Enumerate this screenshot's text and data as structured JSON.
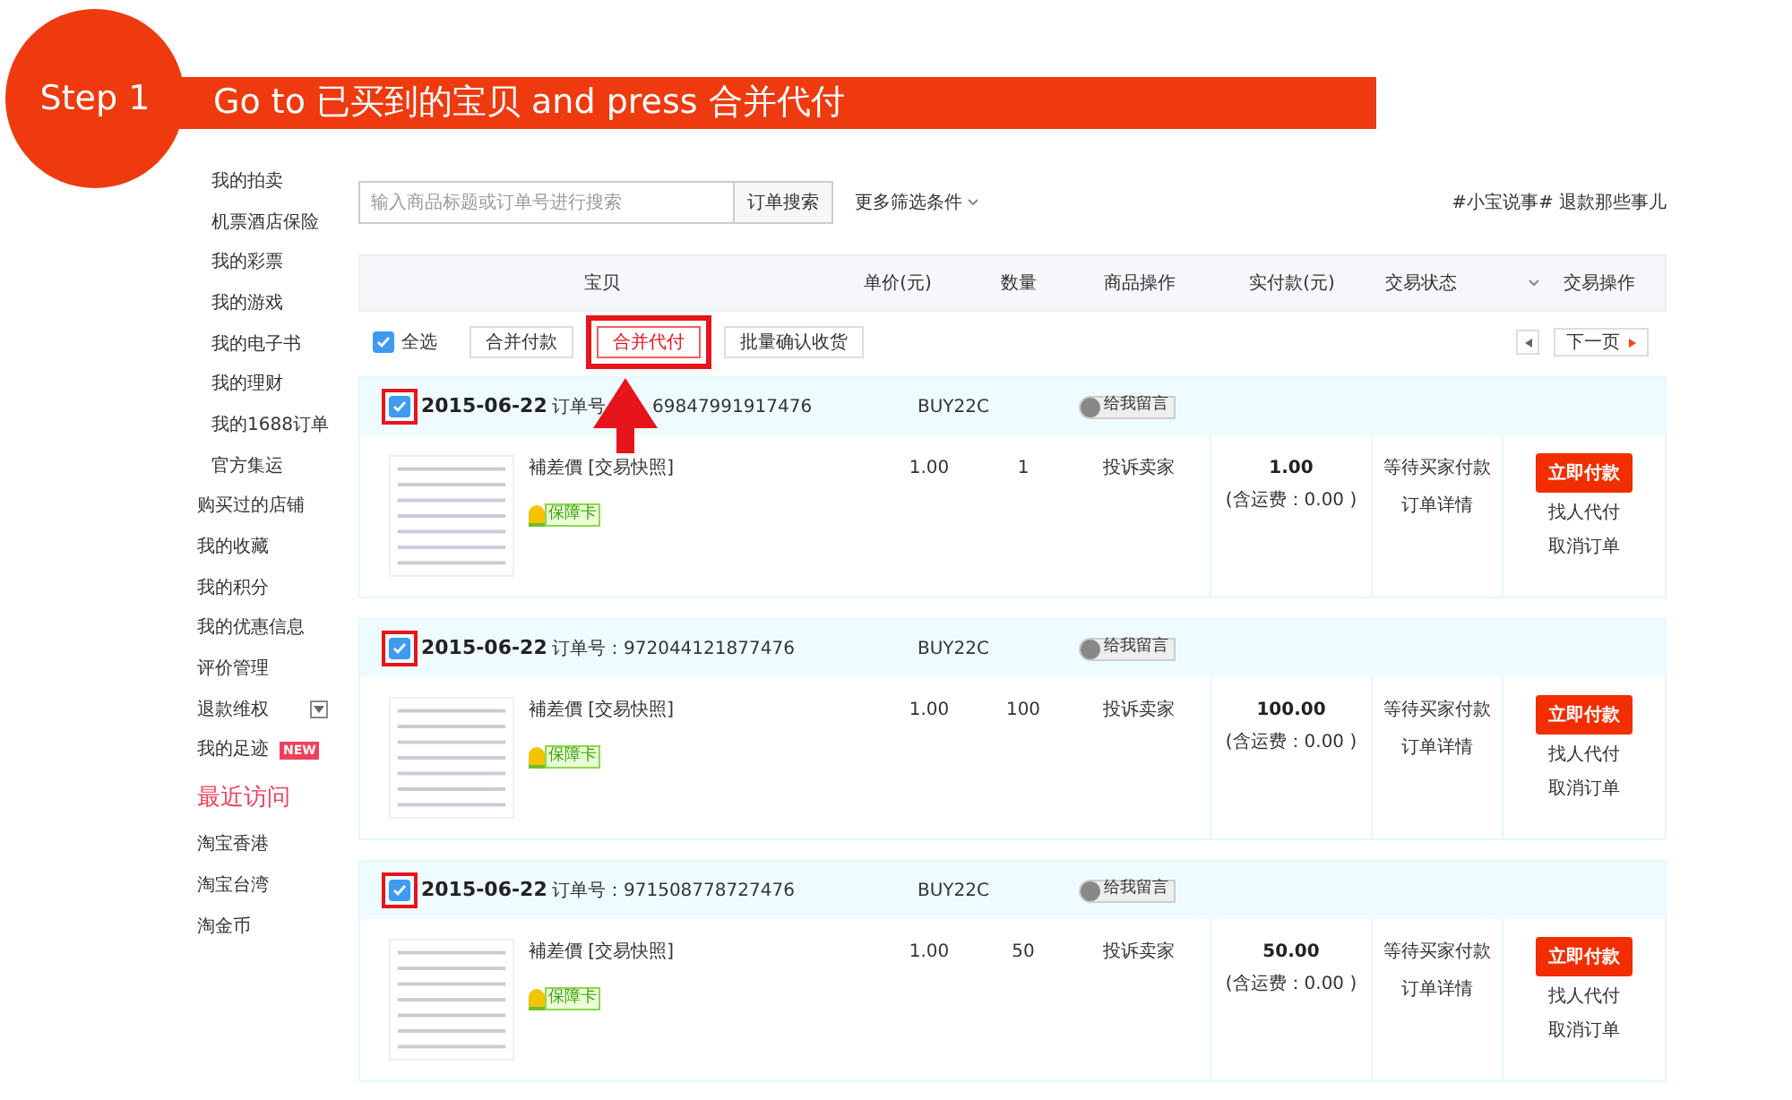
{
  "banner": {
    "step": "Step 1",
    "text": "Go to 已买到的宝贝 and press 合并代付"
  },
  "sidebar": {
    "items": [
      {
        "label": "我的拍卖",
        "kind": "sub"
      },
      {
        "label": "机票酒店保险",
        "kind": "sub"
      },
      {
        "label": "我的彩票",
        "kind": "sub"
      },
      {
        "label": "我的游戏",
        "kind": "sub"
      },
      {
        "label": "我的电子书",
        "kind": "sub"
      },
      {
        "label": "我的理财",
        "kind": "sub"
      },
      {
        "label": "我的1688订单",
        "kind": "sub"
      },
      {
        "label": "官方集运",
        "kind": "sub"
      },
      {
        "label": "购买过的店铺",
        "kind": "main"
      },
      {
        "label": "我的收藏",
        "kind": "main"
      },
      {
        "label": "我的积分",
        "kind": "main"
      },
      {
        "label": "我的优惠信息",
        "kind": "main"
      },
      {
        "label": "评价管理",
        "kind": "main"
      },
      {
        "label": "退款维权",
        "kind": "menu"
      },
      {
        "label": "我的足迹",
        "kind": "main",
        "badge": "NEW"
      },
      {
        "label": "最近访问",
        "kind": "heading"
      },
      {
        "label": "淘宝香港",
        "kind": "main"
      },
      {
        "label": "淘宝台湾",
        "kind": "main"
      },
      {
        "label": "淘金币",
        "kind": "main"
      }
    ]
  },
  "search": {
    "placeholder": "输入商品标题或订单号进行搜索",
    "button": "订单搜索",
    "filter": "更多筛选条件"
  },
  "hashtag": "#小宝说事# 退款那些事儿",
  "table": {
    "columns": [
      {
        "label": "宝贝",
        "kind": "plain"
      },
      {
        "label": "单价(元)",
        "kind": "plain"
      },
      {
        "label": "数量",
        "kind": "plain"
      },
      {
        "label": "商品操作",
        "kind": "plain"
      },
      {
        "label": "实付款(元)",
        "kind": "plain"
      },
      {
        "label": "交易状态",
        "kind": "dropdown"
      },
      {
        "label": "交易操作",
        "kind": "plain"
      }
    ]
  },
  "toolbar": {
    "select_all": {
      "label": "全选",
      "checked": true
    },
    "buttons": [
      {
        "label": "合并付款",
        "highlighted": false
      },
      {
        "label": "合并代付",
        "highlighted": true
      },
      {
        "label": "批量确认收货",
        "highlighted": false
      }
    ],
    "next_page": "下一页"
  },
  "orders": [
    {
      "checked": true,
      "highlighted": true,
      "date": "2015-06-22",
      "order_label": "订单号",
      "order_no": "69847991917476",
      "seller": "BUY22C",
      "message": "给我留言",
      "title": "補差價 [交易快照]",
      "badge": "保障卡",
      "price": "1.00",
      "qty": "1",
      "item_action": "投诉卖家",
      "total": "1.00",
      "shipping": "(含运费：0.00 )",
      "status": "等待买家付款",
      "detail": "订单详情",
      "pay_button": "立即付款",
      "actions": [
        "找人代付",
        "取消订单"
      ]
    },
    {
      "checked": true,
      "highlighted": true,
      "date": "2015-06-22",
      "order_label": "订单号：",
      "order_no": "972044121877476",
      "seller": "BUY22C",
      "message": "给我留言",
      "title": "補差價 [交易快照]",
      "badge": "保障卡",
      "price": "1.00",
      "qty": "100",
      "item_action": "投诉卖家",
      "total": "100.00",
      "shipping": "(含运费：0.00 )",
      "status": "等待买家付款",
      "detail": "订单详情",
      "pay_button": "立即付款",
      "actions": [
        "找人代付",
        "取消订单"
      ]
    },
    {
      "checked": true,
      "highlighted": true,
      "date": "2015-06-22",
      "order_label": "订单号：",
      "order_no": "971508778727476",
      "seller": "BUY22C",
      "message": "给我留言",
      "title": "補差價 [交易快照]",
      "badge": "保障卡",
      "price": "1.00",
      "qty": "50",
      "item_action": "投诉卖家",
      "total": "50.00",
      "shipping": "(含运费：0.00 )",
      "status": "等待买家付款",
      "detail": "订单详情",
      "pay_button": "立即付款",
      "actions": [
        "找人代付",
        "取消订单"
      ]
    }
  ]
}
